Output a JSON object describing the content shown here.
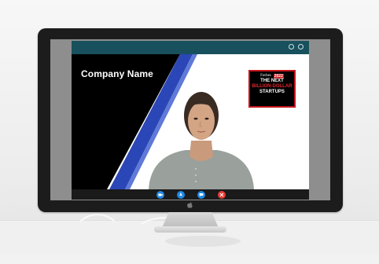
{
  "meeting": {
    "company_name": "Company Name",
    "badge": {
      "brand": "Forbes",
      "year": "2022",
      "line1": "THE NEXT",
      "line2": "BILLION-DOLLAR",
      "line3": "STARTUPS"
    }
  },
  "window_controls": [
    {
      "icon": "minimize-icon"
    },
    {
      "icon": "close-icon"
    }
  ],
  "call_controls": [
    {
      "icon": "video-camera-icon",
      "color": "#1e88e5"
    },
    {
      "icon": "microphone-icon",
      "color": "#1e88e5"
    },
    {
      "icon": "chat-bubble-icon",
      "color": "#1e88e5"
    },
    {
      "icon": "end-call-icon",
      "color": "#e53935"
    }
  ],
  "colors": {
    "topbar": "#18515d",
    "stripe": "#2b46b6",
    "badge_red": "#c4161c"
  }
}
